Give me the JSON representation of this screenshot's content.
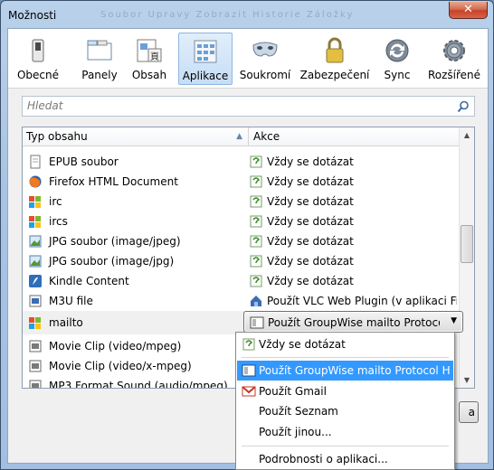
{
  "window": {
    "title": "Možnosti",
    "close_label": "✕",
    "blurred_title": "Soubor  Úpravy  Zobrazit  Historie  Záložky"
  },
  "toolbar": {
    "items": [
      {
        "label": "Obecné",
        "icon": "switch-icon"
      },
      {
        "label": "Panely",
        "icon": "tabs-icon"
      },
      {
        "label": "Obsah",
        "icon": "content-icon"
      },
      {
        "label": "Aplikace",
        "icon": "applications-icon",
        "active": true
      },
      {
        "label": "Soukromí",
        "icon": "mask-icon"
      },
      {
        "label": "Zabezpečení",
        "icon": "padlock-icon"
      },
      {
        "label": "Sync",
        "icon": "sync-icon"
      },
      {
        "label": "Rozšířené",
        "icon": "gear-icon"
      }
    ]
  },
  "search": {
    "placeholder": "Hledat",
    "value": ""
  },
  "table": {
    "col_type": "Typ obsahu",
    "col_action": "Akce",
    "rows": [
      {
        "type": "EPUB soubor",
        "action": "Vždy se dotázat"
      },
      {
        "type": "Firefox HTML Document",
        "action": "Vždy se dotázat"
      },
      {
        "type": "irc",
        "action": "Vždy se dotázat"
      },
      {
        "type": "ircs",
        "action": "Vždy se dotázat"
      },
      {
        "type": "JPG soubor (image/jpeg)",
        "action": "Vždy se dotázat"
      },
      {
        "type": "JPG soubor (image/jpg)",
        "action": "Vždy se dotázat"
      },
      {
        "type": "Kindle Content",
        "action": "Vždy se dotázat"
      },
      {
        "type": "M3U file",
        "action": "Použít VLC Web Plugin (v aplikaci Firefox)"
      },
      {
        "type": "mailto",
        "action": ""
      },
      {
        "type": "Movie Clip (video/mpeg)",
        "action": ""
      },
      {
        "type": "Movie Clip (video/x-mpeg)",
        "action": ""
      },
      {
        "type": "MP3 Format Sound (audio/mpeg)",
        "action": ""
      }
    ]
  },
  "combo": {
    "value": "Použít GroupWise mailto Protocol Handler"
  },
  "dropdown": {
    "items": [
      {
        "label": "Vždy se dotázat",
        "icon": "ask-icon"
      },
      {
        "label": "Použít GroupWise mailto Protocol Handler",
        "icon": "groupwise-icon",
        "highlighted": true
      },
      {
        "label": "Použít Gmail",
        "icon": "gmail-icon"
      },
      {
        "label": "Použít Seznam",
        "icon": ""
      },
      {
        "label": "Použít jinou...",
        "icon": ""
      },
      {
        "label": "Podrobnosti o aplikaci...",
        "icon": ""
      }
    ]
  },
  "side_button": {
    "label": "a"
  },
  "colors": {
    "highlight": "#3399ff",
    "title_bar": "#b9d1ea",
    "close": "#c7432a"
  }
}
